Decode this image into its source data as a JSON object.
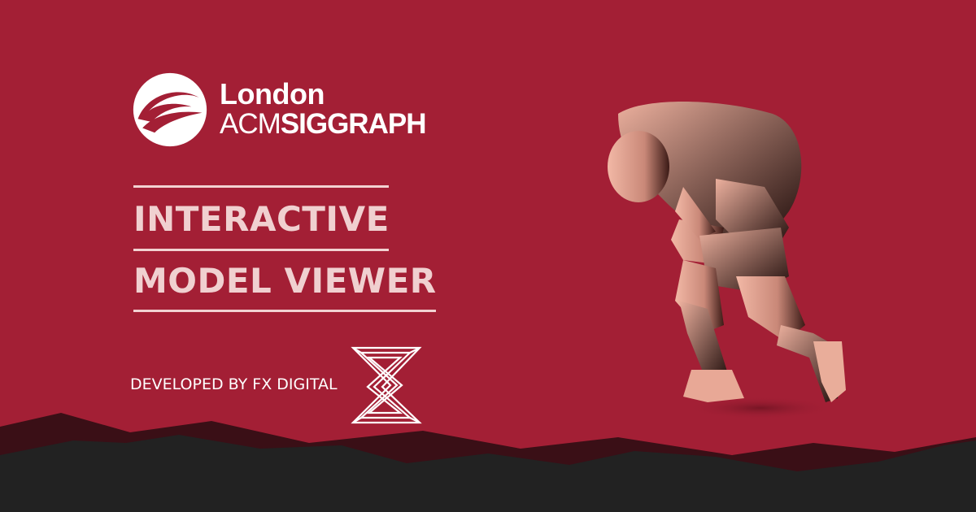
{
  "logo": {
    "city": "London",
    "org_light": "ACM",
    "org_bold": "SIGGRAPH"
  },
  "title": {
    "line1": "INTERACTIVE",
    "line2": "MODEL VIEWER"
  },
  "credit": {
    "text": "DEVELOPED BY FX DIGITAL"
  },
  "colors": {
    "background": "#a31f35",
    "title_text": "#f0d0d0",
    "mountain_dark": "#222222",
    "mountain_deep_red": "#3a0f16",
    "figure_skin": "#e3a898"
  },
  "icons": {
    "logo": "siggraph-logo-icon",
    "brand_mark": "fx-digital-logo-icon"
  }
}
